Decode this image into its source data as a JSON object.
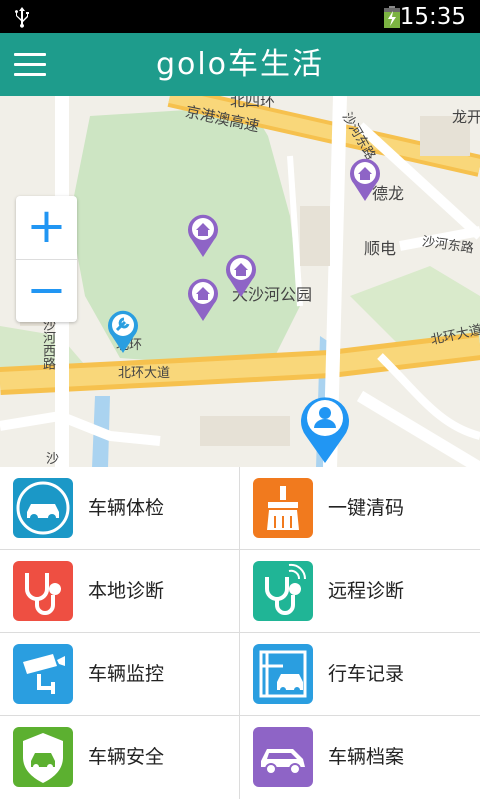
{
  "status_bar": {
    "time": "15:35"
  },
  "app_bar": {
    "title": "golo车生活",
    "menu_icon": "menu-icon"
  },
  "map": {
    "labels": {
      "highway": "京港澳高速",
      "road_top": "北四环",
      "longyu": "龙开",
      "shahe_east_road": "沙河东路",
      "shahe_east_road2": "沙河东路",
      "shunde": "顺电",
      "park": "大沙河公园",
      "shahe_west_road": "沙河西路",
      "beihuan_avenue": "北环大道",
      "beihuan_avenue2": "北环大道",
      "beihuan_east": "北环",
      "bottom_left": "沙",
      "dehong": "德龙"
    },
    "zoom_in": "+",
    "zoom_out": "−"
  },
  "menu": [
    {
      "label": "车辆体检",
      "color": "#1b98c7",
      "icon": "car-icon"
    },
    {
      "label": "一键清码",
      "color": "#f17a1e",
      "icon": "brush-icon"
    },
    {
      "label": "本地诊断",
      "color": "#ee4f42",
      "icon": "stethoscope-icon"
    },
    {
      "label": "远程诊断",
      "color": "#20b596",
      "icon": "remote-stethoscope-icon"
    },
    {
      "label": "车辆监控",
      "color": "#2a9ee0",
      "icon": "camera-icon"
    },
    {
      "label": "行车记录",
      "color": "#2a9ee0",
      "icon": "route-record-icon"
    },
    {
      "label": "车辆安全",
      "color": "#5cb030",
      "icon": "shield-car-icon"
    },
    {
      "label": "车辆档案",
      "color": "#8e64c6",
      "icon": "car-file-icon"
    }
  ]
}
